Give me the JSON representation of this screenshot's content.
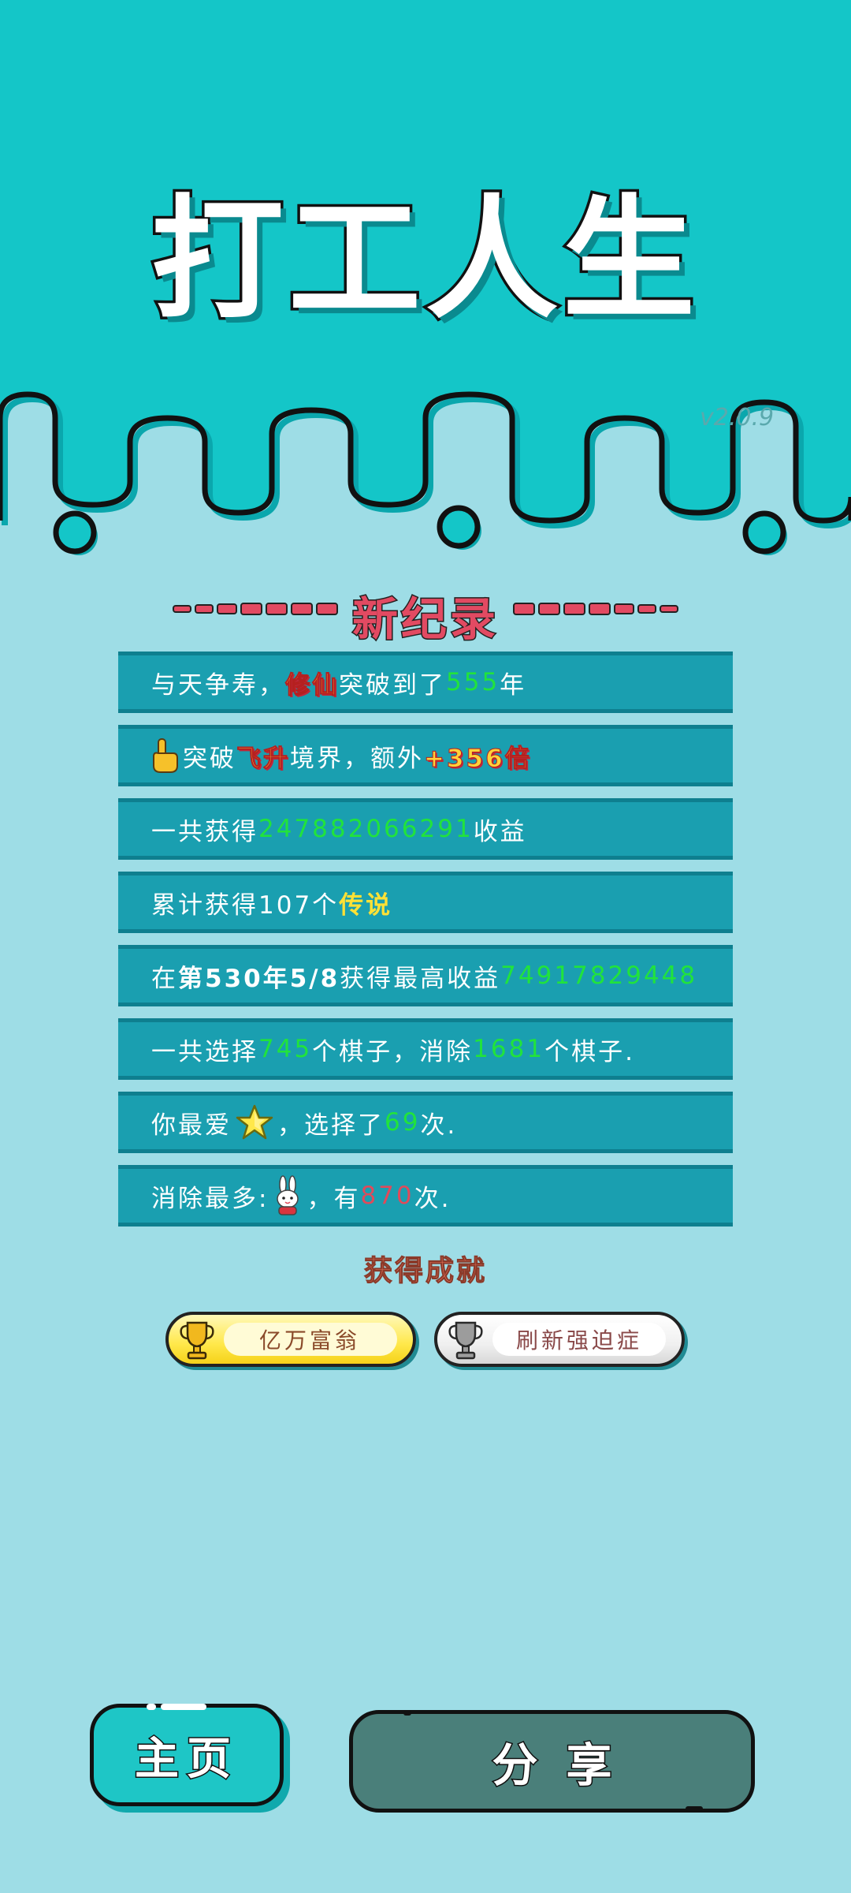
{
  "header": {
    "title": "打工人生",
    "version": "v2.0.9"
  },
  "record": {
    "title": "新纪录",
    "rows": [
      {
        "before": "与天争寿，",
        "tag": "修仙",
        "mid": "突破到了",
        "value": "555",
        "after": "年"
      },
      {
        "before": "突破",
        "tag": "飞升",
        "mid": "境界，额外",
        "bonus": "+356倍"
      },
      {
        "before": "一共获得",
        "value": "247882066291",
        "after": "收益"
      },
      {
        "before": "累计获得107个",
        "tag": "传说"
      },
      {
        "before": "在 ",
        "bold": "第530年5/8",
        "mid": " 获得最高收益",
        "value": "74917829448"
      },
      {
        "before": "一共选择",
        "value": "745",
        "mid": "个棋子，消除",
        "value2": "1681",
        "after": "个棋子."
      },
      {
        "before": "你最爱",
        "icon": "star-icon",
        "mid": "，选择了",
        "value": "69",
        "after": "次."
      },
      {
        "before": "消除最多: ",
        "icon": "rabbit-icon",
        "mid": "，有",
        "value": "870",
        "after": "次."
      }
    ]
  },
  "achievements": {
    "title": "获得成就",
    "badges": [
      {
        "label": "亿万富翁",
        "icon": "gold-trophy-icon"
      },
      {
        "label": "刷新强迫症",
        "icon": "silver-trophy-icon"
      }
    ]
  },
  "buttons": {
    "home": "主页",
    "share": "分享"
  },
  "colors": {
    "header_bg": "#14c6c8",
    "page_bg": "#9edde6",
    "row_bg": "#1a9fb0",
    "value_green": "#21e33c",
    "value_red": "#e04a5a",
    "title_red": "#e24a62",
    "share_bg": "#4a7f7a"
  }
}
